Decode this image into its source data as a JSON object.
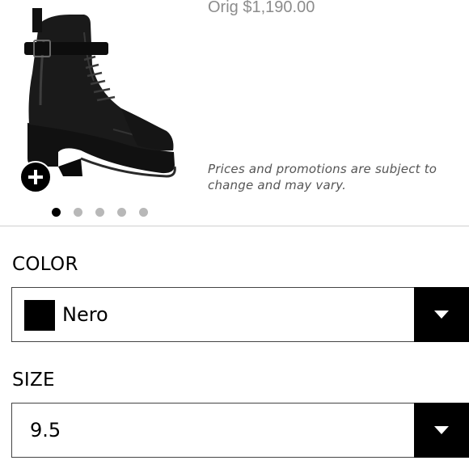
{
  "product": {
    "orig_price": "Orig $1,190.00",
    "disclaimer": "Prices and promotions are subject to change and may vary.",
    "image_name": "black leather combat boot",
    "carousel": {
      "count": 5,
      "active_index": 0
    }
  },
  "color": {
    "label": "COLOR",
    "selected": "Nero",
    "swatch_color": "#000000"
  },
  "size": {
    "label": "SIZE",
    "selected": "9.5"
  },
  "icons": {
    "add": "plus-icon",
    "dropdown": "caret-down-icon"
  }
}
